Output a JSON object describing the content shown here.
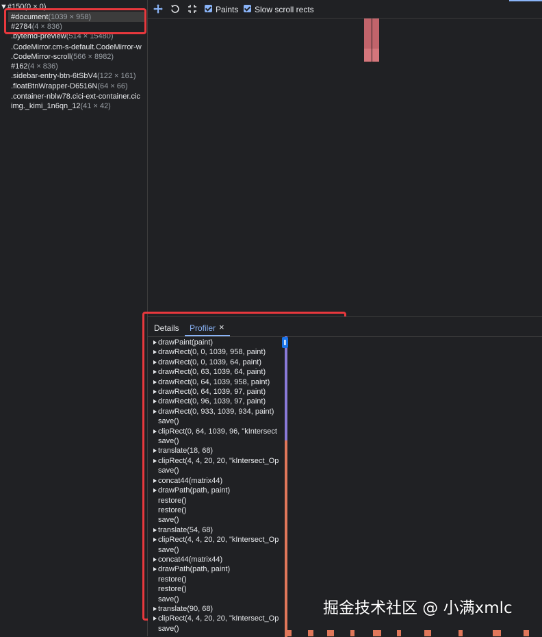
{
  "colors": {
    "panel_bg": "#202124",
    "accent_blue": "#8ab4f8",
    "highlight_red": "#e8383d",
    "layer_pink": "#c2646b",
    "scroll_purple": "#8a7ad8",
    "scroll_orange": "#e0775a"
  },
  "layer_tree": {
    "root": "▼#150(0 × 0)",
    "items": [
      {
        "name": "#document",
        "size": "(1039 × 958)"
      },
      {
        "name": "#2784",
        "size": "(4 × 836)"
      },
      {
        "name": ".bytemd-preview",
        "size": "(514 × 15480)"
      },
      {
        "name": ".CodeMirror.cm-s-default.CodeMirror-w",
        "size": ""
      },
      {
        "name": ".CodeMirror-scroll",
        "size": "(566 × 8982)"
      },
      {
        "name": "#162",
        "size": "(4 × 836)"
      },
      {
        "name": ".sidebar-entry-btn-6tSbV4",
        "size": "(122 × 161)"
      },
      {
        "name": ".floatBtnWrapper-D6516N",
        "size": "(64 × 66)"
      },
      {
        "name": ".container-nblw78.cici-ext-container.cic",
        "size": ""
      },
      {
        "name": "img._kimi_1n6qn_12",
        "size": "(41 × 42)"
      }
    ]
  },
  "toolbar": {
    "pan_icon": "move-icon",
    "rotate_icon": "rotate-icon",
    "reset_icon": "reset-view-icon",
    "paints_label": "Paints",
    "paints_checked": true,
    "slow_scroll_label": "Slow scroll rects",
    "slow_scroll_checked": true
  },
  "bottom_panel": {
    "tabs": [
      {
        "label": "Details",
        "active": false
      },
      {
        "label": "Profiler",
        "active": true,
        "closable": true
      }
    ],
    "close_glyph": "×",
    "commands": [
      {
        "text": "drawPaint(paint)",
        "expandable": true
      },
      {
        "text": "drawRect(0, 0, 1039, 958, paint)",
        "expandable": true
      },
      {
        "text": "drawRect(0, 0, 1039, 64, paint)",
        "expandable": true
      },
      {
        "text": "drawRect(0, 63, 1039, 64, paint)",
        "expandable": true
      },
      {
        "text": "drawRect(0, 64, 1039, 958, paint)",
        "expandable": true
      },
      {
        "text": "drawRect(0, 64, 1039, 97, paint)",
        "expandable": true
      },
      {
        "text": "drawRect(0, 96, 1039, 97, paint)",
        "expandable": true
      },
      {
        "text": "drawRect(0, 933, 1039, 934, paint)",
        "expandable": true
      },
      {
        "text": "save()",
        "expandable": false
      },
      {
        "text": "clipRect(0, 64, 1039, 96, \"kIntersect",
        "expandable": true
      },
      {
        "text": "save()",
        "expandable": false
      },
      {
        "text": "translate(18, 68)",
        "expandable": true
      },
      {
        "text": "clipRect(4, 4, 20, 20, \"kIntersect_Op",
        "expandable": true
      },
      {
        "text": "save()",
        "expandable": false
      },
      {
        "text": "concat44(matrix44)",
        "expandable": true
      },
      {
        "text": "drawPath(path, paint)",
        "expandable": true
      },
      {
        "text": "restore()",
        "expandable": false
      },
      {
        "text": "restore()",
        "expandable": false
      },
      {
        "text": "save()",
        "expandable": false
      },
      {
        "text": "translate(54, 68)",
        "expandable": true
      },
      {
        "text": "clipRect(4, 4, 20, 20, \"kIntersect_Op",
        "expandable": true
      },
      {
        "text": "save()",
        "expandable": false
      },
      {
        "text": "concat44(matrix44)",
        "expandable": true
      },
      {
        "text": "drawPath(path, paint)",
        "expandable": true
      },
      {
        "text": "restore()",
        "expandable": false
      },
      {
        "text": "restore()",
        "expandable": false
      },
      {
        "text": "save()",
        "expandable": false
      },
      {
        "text": "translate(90, 68)",
        "expandable": true
      },
      {
        "text": "clipRect(4, 4, 20, 20, \"kIntersect_Op",
        "expandable": true
      },
      {
        "text": "save()",
        "expandable": false
      }
    ]
  },
  "watermark": "掘金技术社区 @ 小满xmlc"
}
